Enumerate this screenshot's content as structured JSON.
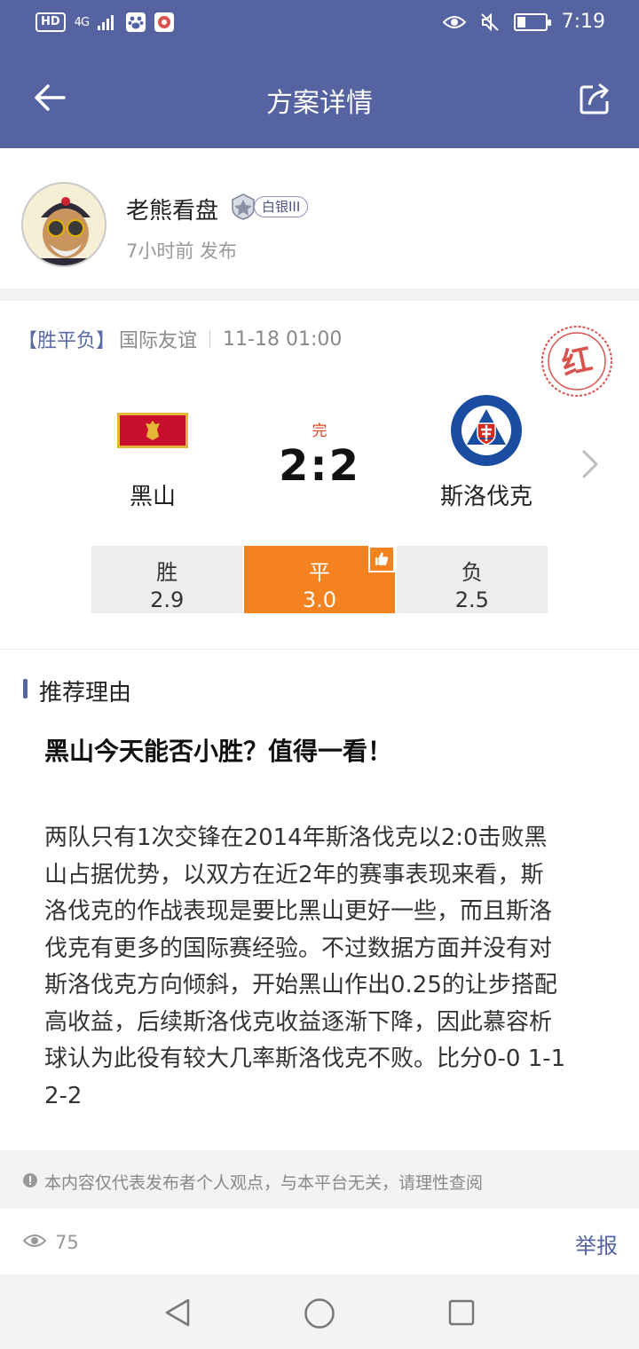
{
  "status_bar": {
    "hd": "HD",
    "network": "4G",
    "time": "7:19",
    "battery_level": 0.3
  },
  "app_bar": {
    "title": "方案详情"
  },
  "author": {
    "name": "老熊看盘",
    "rank": "白银III",
    "published": "7小时前 发布"
  },
  "match": {
    "market": "【胜平负】",
    "league": "国际友谊",
    "datetime": "11-18  01:00",
    "stamp": "红",
    "home_team": "黑山",
    "away_team": "斯洛伐克",
    "status": "完",
    "score": "2:2",
    "odds": [
      {
        "label": "胜",
        "value": "2.9",
        "selected": false
      },
      {
        "label": "平",
        "value": "3.0",
        "selected": true
      },
      {
        "label": "负",
        "value": "2.5",
        "selected": false
      }
    ],
    "colors": {
      "selected": "#f4821f",
      "accent": "#5563a0",
      "stamp": "#d9534f"
    }
  },
  "reason": {
    "section_title": "推荐理由",
    "headline": "黑山今天能否小胜？值得一看！",
    "lines": [
      "两队只有1次交锋在2014年斯洛伐克以2:0击败黑",
      "山占据优势，以双方在近2年的赛事表现来看，斯",
      "洛伐克的作战表现是要比黑山更好一些，而且斯洛",
      "伐克有更多的国际赛经验。不过数据方面并没有对",
      "斯洛伐克方向倾斜，开始黑山作出0.25的让步搭配",
      "高收益，后续斯洛伐克收益逐渐下降，因此慕容析",
      "球认为此役有较大几率斯洛伐克不败。比分0-0 1-1",
      "2-2"
    ]
  },
  "disclaimer": "本内容仅代表发布者个人观点，与本平台无关，请理性查阅",
  "footer": {
    "views": "75",
    "report": "举报"
  }
}
